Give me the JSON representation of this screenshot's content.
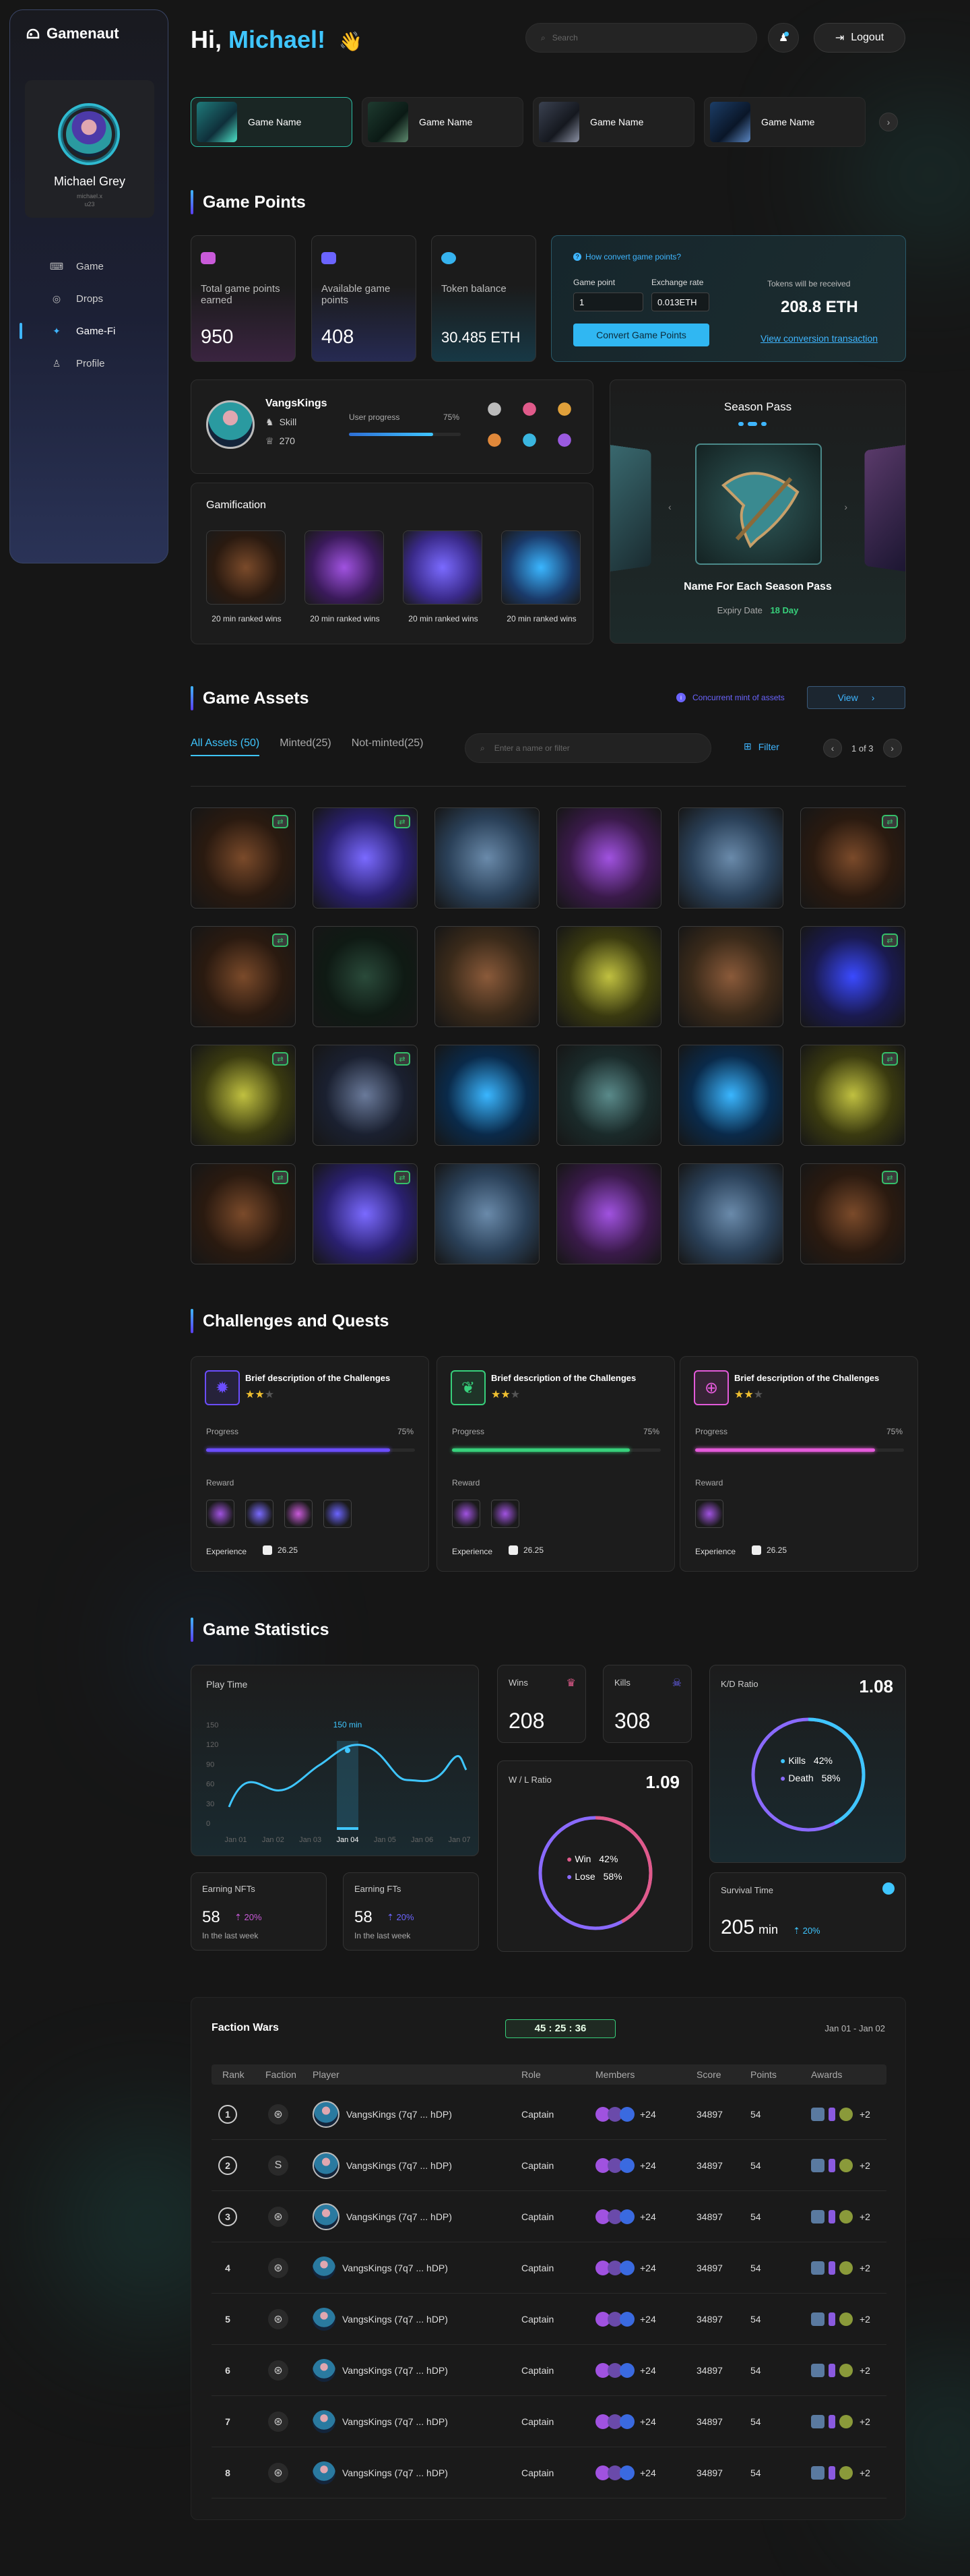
{
  "brand": {
    "name": "Gamenaut",
    "accent": "#3fc6ff"
  },
  "sidebar": {
    "profile": {
      "name": "Michael Grey",
      "sub1": "michael.x",
      "sub2": "u23"
    },
    "items": [
      {
        "label": "Game",
        "icon": "gamepad-icon"
      },
      {
        "label": "Drops",
        "icon": "drops-icon"
      },
      {
        "label": "Game-Fi",
        "icon": "gamefi-icon",
        "active": true
      },
      {
        "label": "Profile",
        "icon": "user-icon"
      }
    ]
  },
  "header": {
    "greeting": "Hi, ",
    "name": "Michael!",
    "wave": "👋",
    "search_placeholder": "Search",
    "logout_label": "Logout"
  },
  "games": {
    "tabs": [
      "Game Name",
      "Game Name",
      "Game Name",
      "Game Name"
    ],
    "next": "›"
  },
  "game_points": {
    "title": "Game Points",
    "stats": [
      {
        "label": "Total game points earned",
        "value": "950"
      },
      {
        "label": "Available game points",
        "value": "408"
      },
      {
        "label": "Token balance",
        "value": "30.485 ETH"
      }
    ],
    "convert": {
      "help": "How convert game points?",
      "point_label": "Game point",
      "point_value": "1",
      "rate_label": "Exchange rate",
      "rate_value": "0.013ETH",
      "button": "Convert Game Points",
      "receive_label": "Tokens will be received",
      "receive_value": "208.8 ETH",
      "link": "View conversion transaction"
    }
  },
  "user_card": {
    "name": "VangsKings",
    "skill": "Skill",
    "trophies": "270",
    "progress_label": "User progress",
    "progress_value": "75%",
    "progress": 0.75
  },
  "season_pass": {
    "title": "Season Pass",
    "name": "Name For Each Season Pass",
    "expiry_label": "Expiry Date",
    "expiry_value": "18 Day"
  },
  "gamification": {
    "title": "Gamification",
    "items": [
      "20 min ranked wins",
      "20 min ranked wins",
      "20 min ranked wins",
      "20 min ranked wins"
    ]
  },
  "assets": {
    "title": "Game Assets",
    "mint_label": "Concurrent mint of assets",
    "view_label": "View",
    "tabs": [
      "All Assets (50)",
      "Minted(25)",
      "Not-minted(25)"
    ],
    "search_placeholder": "Enter a name or filter",
    "filter_label": "Filter",
    "page": "1 of 3"
  },
  "challenges": {
    "title": "Challenges and Quests",
    "items": [
      {
        "desc": "Brief description of the Challenges",
        "progress_label": "Progress",
        "progress_value": "75%",
        "progress": 0.88,
        "color": "#6b4dff",
        "reward_label": "Reward",
        "exp_label": "Experience",
        "exp_value": "26.25"
      },
      {
        "desc": "Brief description of the Challenges",
        "progress_label": "Progress",
        "progress_value": "75%",
        "progress": 0.85,
        "color": "#37d07b",
        "reward_label": "Reward",
        "exp_label": "Experience",
        "exp_value": "26.25"
      },
      {
        "desc": "Brief description of the Challenges",
        "progress_label": "Progress",
        "progress_value": "75%",
        "progress": 0.86,
        "color": "#e35ad9",
        "reward_label": "Reward",
        "exp_label": "Experience",
        "exp_value": "26.25"
      }
    ]
  },
  "statistics": {
    "title": "Game Statistics",
    "playtime": {
      "title": "Play Time",
      "peak": "150 min",
      "yticks": [
        "150",
        "120",
        "90",
        "60",
        "30",
        "0"
      ],
      "days": [
        "Jan 01",
        "Jan 02",
        "Jan 03",
        "Jan 04",
        "Jan 05",
        "Jan 06",
        "Jan 07"
      ]
    },
    "wins": {
      "label": "Wins",
      "value": "208"
    },
    "kills": {
      "label": "Kills",
      "value": "308"
    },
    "wl": {
      "label": "W / L Ratio",
      "value": "1.09",
      "win_label": "Win",
      "win": "42%",
      "lose_label": "Lose",
      "lose": "58%"
    },
    "kd": {
      "label": "K/D Ratio",
      "value": "1.08",
      "kills_label": "Kills",
      "kills": "42%",
      "death_label": "Death",
      "death": "58%"
    },
    "nfts": {
      "label": "Earning NFTs",
      "value": "58",
      "change": "20%",
      "period": "In the last week"
    },
    "fts": {
      "label": "Earning FTs",
      "value": "58",
      "change": "20%",
      "period": "In the last week"
    },
    "survival": {
      "label": "Survival Time",
      "value": "205",
      "unit": "min",
      "change": "20%"
    }
  },
  "faction_wars": {
    "title": "Faction Wars",
    "timer": "45 : 25 : 36",
    "range": "Jan 01 - Jan 02",
    "headers": [
      "Rank",
      "Faction",
      "Player",
      "Role",
      "Members",
      "Score",
      "Points",
      "Awards"
    ],
    "rows": [
      {
        "rank": "1",
        "player": "VangsKings (7q7 ... hDP)",
        "role": "Captain",
        "members": "+24",
        "score": "34897",
        "points": "54",
        "awards": "+2"
      },
      {
        "rank": "2",
        "player": "VangsKings (7q7 ... hDP)",
        "role": "Captain",
        "members": "+24",
        "score": "34897",
        "points": "54",
        "awards": "+2"
      },
      {
        "rank": "3",
        "player": "VangsKings (7q7 ... hDP)",
        "role": "Captain",
        "members": "+24",
        "score": "34897",
        "points": "54",
        "awards": "+2"
      },
      {
        "rank": "4",
        "player": "VangsKings (7q7 ... hDP)",
        "role": "Captain",
        "members": "+24",
        "score": "34897",
        "points": "54",
        "awards": "+2"
      },
      {
        "rank": "5",
        "player": "VangsKings (7q7 ... hDP)",
        "role": "Captain",
        "members": "+24",
        "score": "34897",
        "points": "54",
        "awards": "+2"
      },
      {
        "rank": "6",
        "player": "VangsKings (7q7 ... hDP)",
        "role": "Captain",
        "members": "+24",
        "score": "34897",
        "points": "54",
        "awards": "+2"
      },
      {
        "rank": "7",
        "player": "VangsKings (7q7 ... hDP)",
        "role": "Captain",
        "members": "+24",
        "score": "34897",
        "points": "54",
        "awards": "+2"
      },
      {
        "rank": "8",
        "player": "VangsKings (7q7 ... hDP)",
        "role": "Captain",
        "members": "+24",
        "score": "34897",
        "points": "54",
        "awards": "+2"
      }
    ]
  }
}
